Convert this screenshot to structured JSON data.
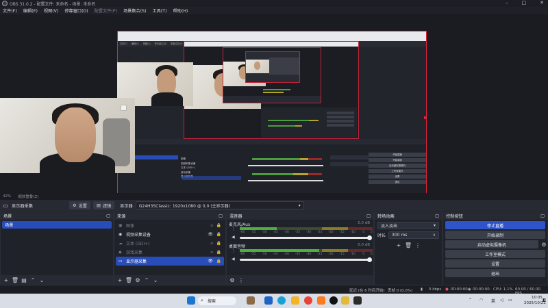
{
  "window": {
    "title": "OBS 31.0.2 - 配置文件: 未命名 - 场景: 未命名"
  },
  "menu": [
    "文件(F)",
    "编辑(E)",
    "视图(V)",
    "停靠窗口(D)",
    "配置文件(P)",
    "场景集合(S)",
    "工具(T)",
    "帮助(H)"
  ],
  "menu_dim_index": 4,
  "preview_strip": {
    "zoom": "42%",
    "mode": "缩放重叠(Z)"
  },
  "source_toolbar": {
    "source_name": "显示器采集",
    "properties_label": "设置",
    "filters_label": "滤镜",
    "display_label": "显示器",
    "display_value": "G24H3SClassic: 1920x1080 @ 0,0 (主显示器)"
  },
  "scenes": {
    "title": "场景",
    "items": [
      "场景"
    ]
  },
  "sources": {
    "title": "来源",
    "items": [
      {
        "icon": "image-icon",
        "glyph": "▣",
        "label": "图像",
        "visible": false,
        "state": "dim"
      },
      {
        "icon": "camera-icon",
        "glyph": "◉",
        "label": "视频采集设备",
        "visible": true,
        "state": "normal"
      },
      {
        "icon": "text-icon",
        "glyph": "☁",
        "label": "文本 (GDI+)",
        "visible": false,
        "state": "dim"
      },
      {
        "icon": "game-icon",
        "glyph": "◆",
        "label": "游戏采集",
        "visible": false,
        "state": "dim"
      },
      {
        "icon": "monitor-icon",
        "glyph": "▭",
        "label": "显示器采集",
        "visible": true,
        "state": "selected"
      }
    ]
  },
  "mixer": {
    "title": "混音器",
    "ticks": [
      "-60",
      "-55",
      "-50",
      "-45",
      "-40",
      "-35",
      "-30",
      "-25",
      "-20",
      "-15",
      "-10",
      "-5",
      "0"
    ],
    "channels": [
      {
        "name": "麦克风/Aux",
        "db": "0.0 dB",
        "level": 0.28
      },
      {
        "name": "桌面音频",
        "db": "0.0 dB",
        "level": 0.6
      }
    ]
  },
  "transitions": {
    "title": "转场动画",
    "selected": "淡入淡出",
    "duration_label": "时长",
    "duration_value": "300 ms"
  },
  "controls": {
    "title": "控制按钮",
    "buttons": [
      "停止直播",
      "开始录制",
      "启动虚拟摄像机",
      "工作室模式",
      "设置",
      "退出"
    ]
  },
  "status": {
    "reconnect": "延迟 (在 6 秒后开始)",
    "dropped": "丢帧 0 (0.0%)",
    "bitrate": "0 kbps",
    "live_time": "00:00:00",
    "rec_time": "00:00:00",
    "cpu": "CPU: 1.1%",
    "fps": "60.00 / 60.00 FPS"
  },
  "taskbar": {
    "search": "搜索",
    "lang": "英",
    "time": "10:05",
    "date": "2025/10/22"
  },
  "nested_screen": {
    "menu": [
      "文件(F)",
      "编辑(E)",
      "视图(V)",
      "停靠窗口(D)",
      "配置文件(P)",
      "场景集合(S)",
      "工具(T)",
      "帮助(H)"
    ],
    "sources": [
      "图像",
      "视频采集设备",
      "文本 (GDI+)",
      "游戏采集",
      "显示器采集"
    ],
    "controls": [
      "开始直播",
      "开始录制",
      "启动虚拟摄像机",
      "工作室模式",
      "设置",
      "退出"
    ]
  }
}
